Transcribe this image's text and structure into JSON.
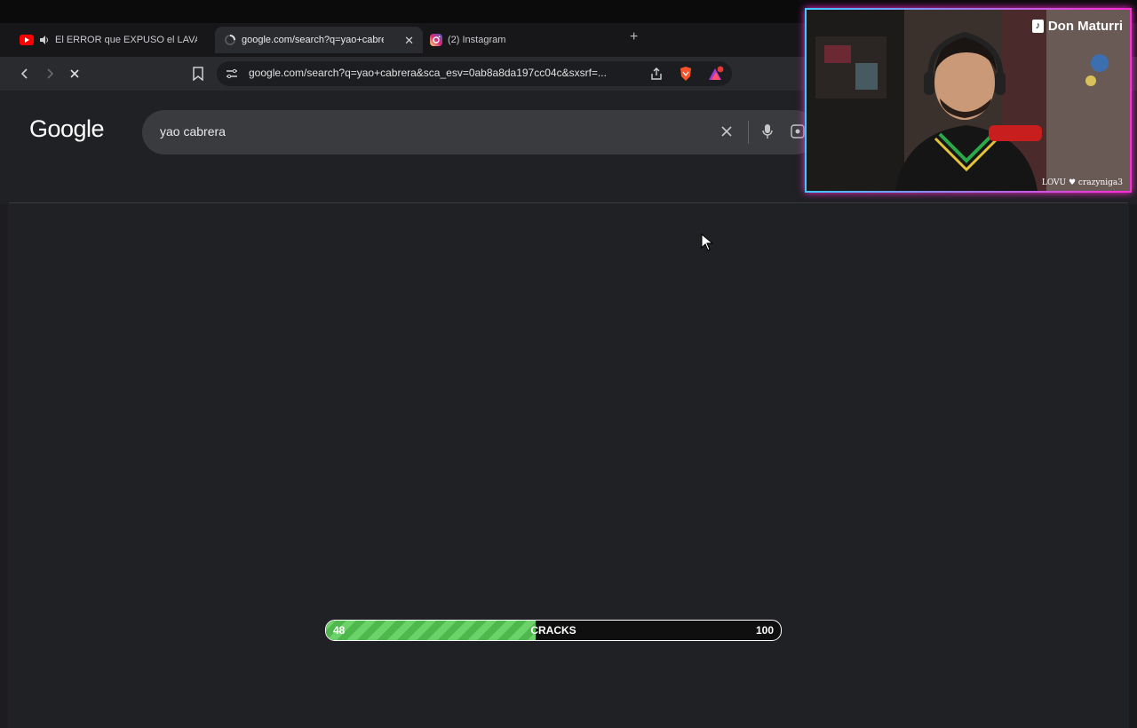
{
  "tabs": [
    {
      "title": "El ERROR que EXPUSO el LAVADO",
      "icon": "youtube-icon",
      "audio": true
    },
    {
      "title": "google.com/search?q=yao+cabrera",
      "icon": "loading-spinner-icon",
      "active": true
    },
    {
      "title": "(2) Instagram",
      "icon": "instagram-icon"
    }
  ],
  "address_bar": {
    "url": "google.com/search?q=yao+cabrera&sca_esv=0ab8a8da197cc04c&sxsrf=..."
  },
  "google": {
    "logo": "Google",
    "query": "yao cabrera"
  },
  "stream": {
    "streamer_name": "Don Maturri",
    "lower_caption": "LOVU ♥ crazyniga3",
    "cracks_bar": {
      "label": "CRACKS",
      "current": "48",
      "max": "100",
      "fill_fraction": 0.46
    }
  },
  "colors": {
    "frame_gradient_start": "#3ec9ff",
    "frame_gradient_end": "#ff2bd6",
    "bar_green": "#6cd36a",
    "brave_orange": "#fb542b",
    "page_bg": "#202124"
  }
}
